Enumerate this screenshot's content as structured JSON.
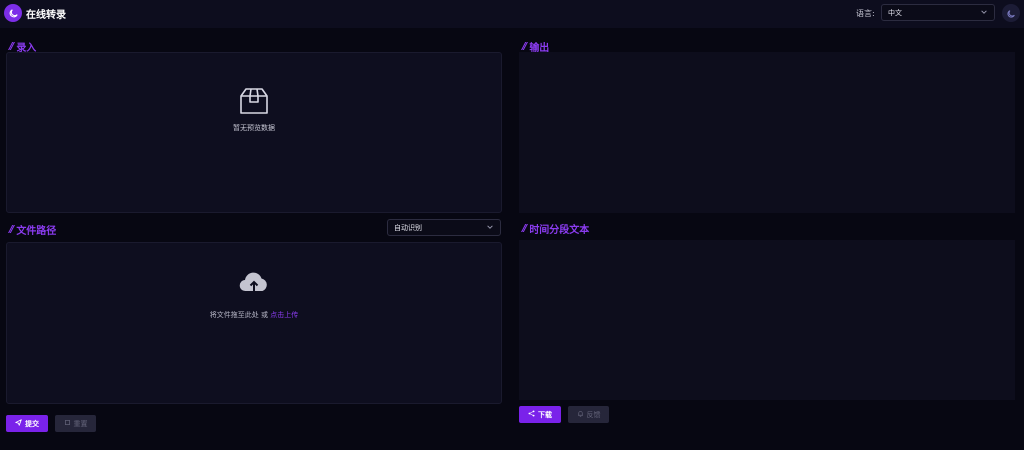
{
  "header": {
    "title": "在线转录",
    "language_label": "语言:",
    "language_value": "中文"
  },
  "left": {
    "record_title": "录入",
    "record_empty_text": "暂无预览数据",
    "file_title": "文件路径",
    "mode_value": "自动识别",
    "upload_text": "将文件拖至此处 或 ",
    "upload_link": "点击上传",
    "submit_label": "提交",
    "reset_label": "重置"
  },
  "right": {
    "output_title": "输出",
    "timestamp_title": "时间分段文本",
    "download_label": "下载",
    "feedback_label": "反馈"
  },
  "colors": {
    "accent": "#7a22ea",
    "background": "#070712",
    "panel": "#0e0e1f"
  },
  "icons": [
    "moon-logo-icon",
    "chevron-down-icon",
    "moon-icon",
    "box-icon",
    "cloud-upload-icon",
    "send-icon",
    "reset-icon",
    "share-icon",
    "bell-icon"
  ]
}
